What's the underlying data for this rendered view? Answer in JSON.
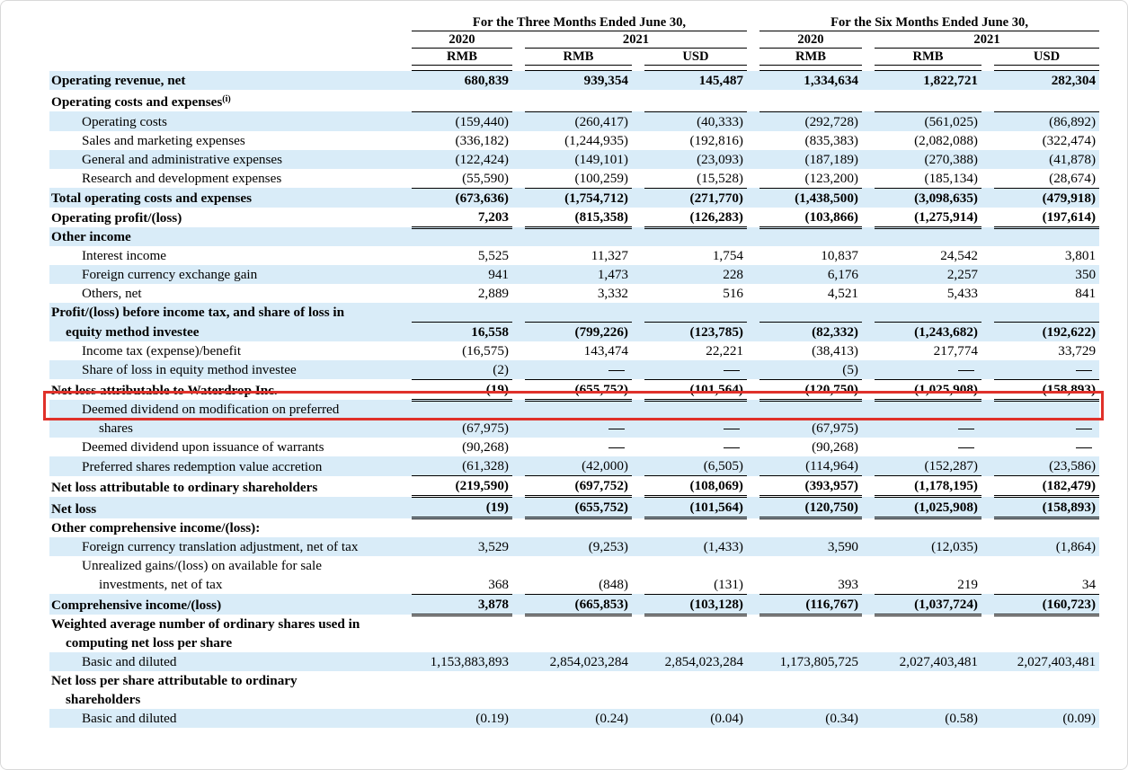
{
  "header": {
    "group1": "For the Three Months Ended June 30,",
    "group2": "For the Six Months Ended June 30,",
    "years": [
      "2020",
      "2021",
      "2020",
      "2021"
    ],
    "currencies": [
      "RMB",
      "RMB",
      "USD",
      "RMB",
      "RMB",
      "USD"
    ]
  },
  "dash": "—",
  "rows": {
    "r1": {
      "label": "Operating revenue, net",
      "v": [
        "680,839",
        "939,354",
        "145,487",
        "1,334,634",
        "1,822,721",
        "282,304"
      ]
    },
    "r2": {
      "label": "Operating costs and expenses",
      "sup": "(i)"
    },
    "r3": {
      "label": "Operating costs",
      "v": [
        "(159,440)",
        "(260,417)",
        "(40,333)",
        "(292,728)",
        "(561,025)",
        "(86,892)"
      ]
    },
    "r4": {
      "label": "Sales and marketing expenses",
      "v": [
        "(336,182)",
        "(1,244,935)",
        "(192,816)",
        "(835,383)",
        "(2,082,088)",
        "(322,474)"
      ]
    },
    "r5": {
      "label": "General and administrative expenses",
      "v": [
        "(122,424)",
        "(149,101)",
        "(23,093)",
        "(187,189)",
        "(270,388)",
        "(41,878)"
      ]
    },
    "r6": {
      "label": "Research and development expenses",
      "v": [
        "(55,590)",
        "(100,259)",
        "(15,528)",
        "(123,200)",
        "(185,134)",
        "(28,674)"
      ]
    },
    "r7": {
      "label": "Total operating costs and expenses",
      "v": [
        "(673,636)",
        "(1,754,712)",
        "(271,770)",
        "(1,438,500)",
        "(3,098,635)",
        "(479,918)"
      ]
    },
    "r8": {
      "label": "Operating profit/(loss)",
      "v": [
        "7,203",
        "(815,358)",
        "(126,283)",
        "(103,866)",
        "(1,275,914)",
        "(197,614)"
      ]
    },
    "r9": {
      "label": "Other income"
    },
    "r10": {
      "label": "Interest income",
      "v": [
        "5,525",
        "11,327",
        "1,754",
        "10,837",
        "24,542",
        "3,801"
      ]
    },
    "r11": {
      "label": "Foreign currency exchange gain",
      "v": [
        "941",
        "1,473",
        "228",
        "6,176",
        "2,257",
        "350"
      ]
    },
    "r12": {
      "label": "Others, net",
      "v": [
        "2,889",
        "3,332",
        "516",
        "4,521",
        "5,433",
        "841"
      ]
    },
    "r13": {
      "label": "Profit/(loss) before income tax, and share of loss in",
      "label2": "equity method investee",
      "v": [
        "16,558",
        "(799,226)",
        "(123,785)",
        "(82,332)",
        "(1,243,682)",
        "(192,622)"
      ]
    },
    "r14": {
      "label": "Income tax (expense)/benefit",
      "v": [
        "(16,575)",
        "143,474",
        "22,221",
        "(38,413)",
        "217,774",
        "33,729"
      ]
    },
    "r15": {
      "label": "Share of loss in equity method investee",
      "v": [
        "(2)",
        "—",
        "—",
        "(5)",
        "—",
        "—"
      ]
    },
    "r16": {
      "label": "Net loss attributable to Waterdrop Inc.",
      "v": [
        "(19)",
        "(655,752)",
        "(101,564)",
        "(120,750)",
        "(1,025,908)",
        "(158,893)"
      ]
    },
    "r17": {
      "label": "Deemed dividend on modification on preferred",
      "label2": "shares",
      "v": [
        "(67,975)",
        "—",
        "—",
        "(67,975)",
        "—",
        "—"
      ]
    },
    "r18": {
      "label": "Deemed dividend upon issuance of warrants",
      "v": [
        "(90,268)",
        "—",
        "—",
        "(90,268)",
        "—",
        "—"
      ]
    },
    "r19": {
      "label": "Preferred shares redemption value accretion",
      "v": [
        "(61,328)",
        "(42,000)",
        "(6,505)",
        "(114,964)",
        "(152,287)",
        "(23,586)"
      ]
    },
    "r20": {
      "label": "Net loss attributable to ordinary shareholders",
      "v": [
        "(219,590)",
        "(697,752)",
        "(108,069)",
        "(393,957)",
        "(1,178,195)",
        "(182,479)"
      ]
    },
    "r21": {
      "label": "Net loss",
      "v": [
        "(19)",
        "(655,752)",
        "(101,564)",
        "(120,750)",
        "(1,025,908)",
        "(158,893)"
      ]
    },
    "r22": {
      "label": "Other comprehensive income/(loss):"
    },
    "r23": {
      "label": "Foreign currency translation adjustment, net of tax",
      "v": [
        "3,529",
        "(9,253)",
        "(1,433)",
        "3,590",
        "(12,035)",
        "(1,864)"
      ]
    },
    "r24": {
      "label": "Unrealized gains/(loss) on available for sale",
      "label2": "investments, net of tax",
      "v": [
        "368",
        "(848)",
        "(131)",
        "393",
        "219",
        "34"
      ]
    },
    "r25": {
      "label": "Comprehensive income/(loss)",
      "v": [
        "3,878",
        "(665,853)",
        "(103,128)",
        "(116,767)",
        "(1,037,724)",
        "(160,723)"
      ]
    },
    "r26": {
      "label": "Weighted average number of ordinary shares used in",
      "label2": "computing net loss per share"
    },
    "r27": {
      "label": "Basic and diluted",
      "v": [
        "1,153,883,893",
        "2,854,023,284",
        "2,854,023,284",
        "1,173,805,725",
        "2,027,403,481",
        "2,027,403,481"
      ]
    },
    "r28": {
      "label": "Net loss per share attributable to ordinary",
      "label2": "shareholders"
    },
    "r29": {
      "label": "Basic and diluted",
      "v": [
        "(0.19)",
        "(0.24)",
        "(0.04)",
        "(0.34)",
        "(0.58)",
        "(0.09)"
      ]
    }
  },
  "colors": {
    "row_highlight": "#d9ecf8",
    "highlight_box": "#e0312a"
  }
}
